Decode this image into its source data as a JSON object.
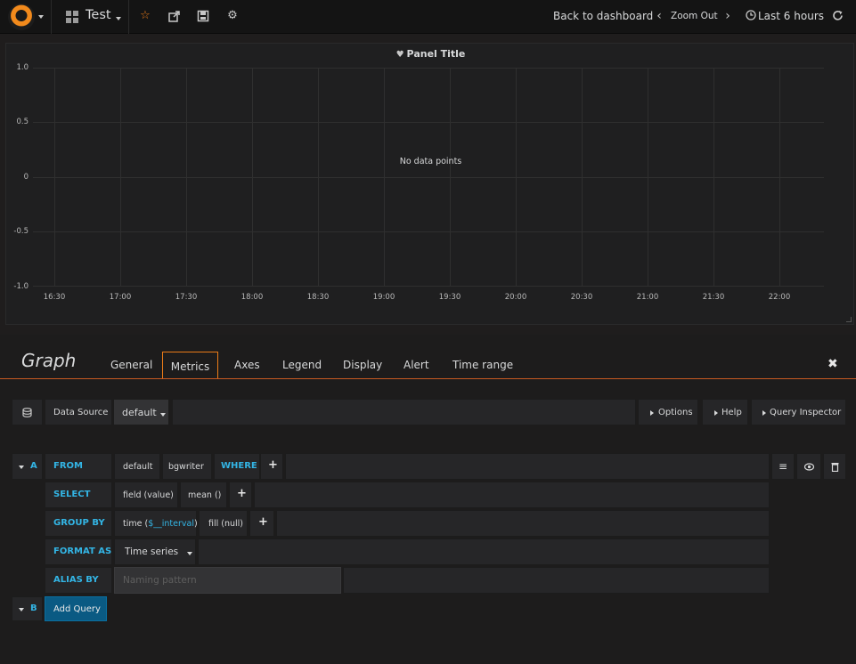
{
  "navbar": {
    "dashboard_title": "Test",
    "back_to_dashboard": "Back to dashboard",
    "zoom_out": "Zoom Out",
    "time_range": "Last 6 hours"
  },
  "panel": {
    "title": "Panel Title",
    "no_data": "No data points",
    "y_ticks": [
      "1.0",
      "0.5",
      "0",
      "-0.5",
      "-1.0"
    ],
    "x_ticks": [
      "16:30",
      "17:00",
      "17:30",
      "18:00",
      "18:30",
      "19:00",
      "19:30",
      "20:00",
      "20:30",
      "21:00",
      "21:30",
      "22:00"
    ]
  },
  "chart_data": {
    "type": "line",
    "title": "Panel Title",
    "series": [],
    "x": [
      "16:30",
      "17:00",
      "17:30",
      "18:00",
      "18:30",
      "19:00",
      "19:30",
      "20:00",
      "20:30",
      "21:00",
      "21:30",
      "22:00"
    ],
    "ylim": [
      -1.0,
      1.0
    ],
    "grid": true,
    "annotation": "No data points"
  },
  "editor": {
    "title": "Graph",
    "tabs": [
      "General",
      "Metrics",
      "Axes",
      "Legend",
      "Display",
      "Alert",
      "Time range"
    ],
    "active_tab": "Metrics"
  },
  "datasource": {
    "label": "Data Source",
    "value": "default",
    "options": "Options",
    "help": "Help",
    "query_inspector": "Query Inspector"
  },
  "query_a": {
    "ref": "A",
    "from_kw": "FROM",
    "policy": "default",
    "measurement": "bgwriter",
    "where_kw": "WHERE",
    "select_kw": "SELECT",
    "field": "field (value)",
    "func": "mean ()",
    "groupby_kw": "GROUP BY",
    "time_prefix": "time (",
    "time_interval": "$__interval",
    "time_suffix": ")",
    "fill": "fill (null)",
    "format_kw": "FORMAT AS",
    "format_value": "Time series",
    "alias_kw": "ALIAS BY",
    "alias_placeholder": "Naming pattern"
  },
  "query_b": {
    "ref": "B",
    "add_query": "Add Query"
  },
  "colors": {
    "accent": "#eb7b18",
    "keyword": "#33b5e5",
    "add_button": "#0a5a83"
  }
}
